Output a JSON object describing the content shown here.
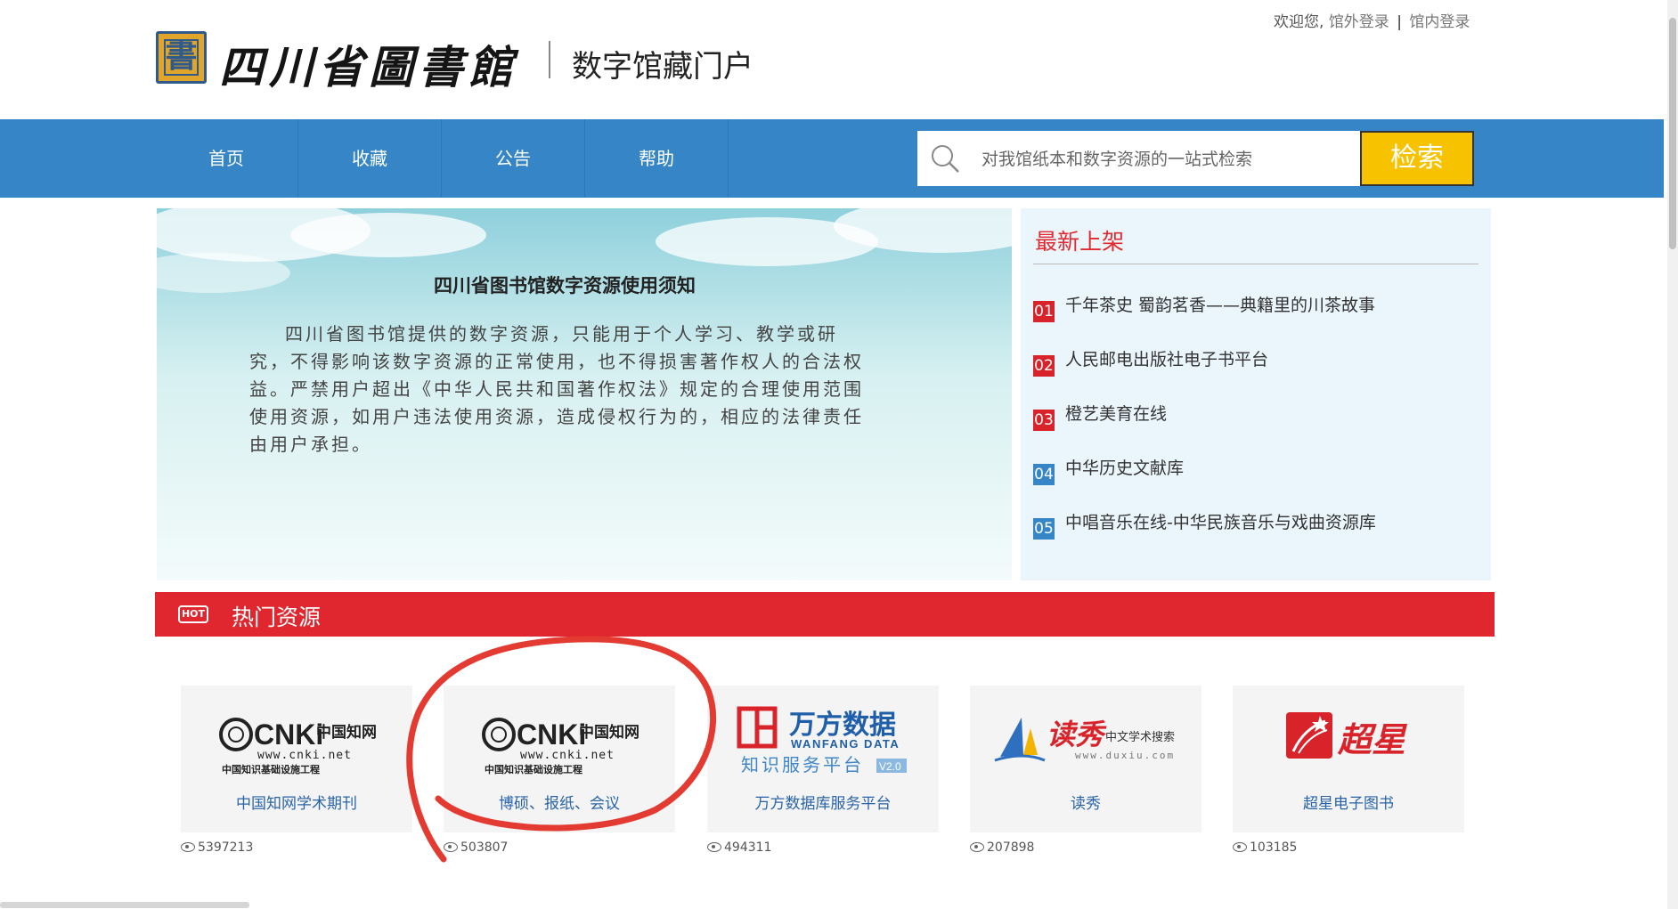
{
  "header": {
    "welcome": "欢迎您,",
    "login_external": "馆外登录",
    "separator": "|",
    "login_internal": "馆内登录",
    "logo_glyph": "書",
    "library_name": "四川省圖書館",
    "portal_title": "数字馆藏门户"
  },
  "nav": {
    "items": [
      {
        "label": "首页"
      },
      {
        "label": "收藏"
      },
      {
        "label": "公告"
      },
      {
        "label": "帮助"
      }
    ],
    "search_placeholder": "对我馆纸本和数字资源的一站式检索",
    "search_button": "检索"
  },
  "notice": {
    "title": "四川省图书馆数字资源使用须知",
    "body": "四川省图书馆提供的数字资源，只能用于个人学习、教学或研究，不得影响该数字资源的正常使用，也不得损害著作权人的合法权益。严禁用户超出《中华人民共和国著作权法》规定的合理使用范围使用资源，如用户违法使用资源，造成侵权行为的，相应的法律责任由用户承担。"
  },
  "latest": {
    "title": "最新上架",
    "items": [
      {
        "num": "01",
        "label": "千年茶史 蜀韵茗香——典籍里的川茶故事"
      },
      {
        "num": "02",
        "label": "人民邮电出版社电子书平台"
      },
      {
        "num": "03",
        "label": "橙艺美育在线"
      },
      {
        "num": "04",
        "label": "中华历史文献库"
      },
      {
        "num": "05",
        "label": "中唱音乐在线-中华民族音乐与戏曲资源库"
      }
    ]
  },
  "hot": {
    "badge": "HOT",
    "title": "热门资源",
    "resources": [
      {
        "name": "中国知网学术期刊",
        "views": "5397213",
        "logo_main": "CNKi",
        "logo_cn": "中国知网",
        "logo_url": "www.cnki.net",
        "logo_sub": "中国知识基础设施工程"
      },
      {
        "name": "博硕、报纸、会议",
        "views": "503807",
        "logo_main": "CNKi",
        "logo_cn": "中国知网",
        "logo_url": "www.cnki.net",
        "logo_sub": "中国知识基础设施工程"
      },
      {
        "name": "万方数据库服务平台",
        "views": "494311",
        "logo_main": "万方数据",
        "logo_en": "WANFANG DATA",
        "logo_sub": "知识服务平台",
        "logo_ver": "V2.0"
      },
      {
        "name": "读秀",
        "views": "207898",
        "logo_main": "读秀",
        "logo_sub": "中文学术搜索",
        "logo_url": "www.duxiu.com"
      },
      {
        "name": "超星电子图书",
        "views": "103185",
        "logo_main": "超星"
      }
    ]
  },
  "colors": {
    "nav_blue": "#3585c7",
    "hot_red": "#e0262e",
    "search_yellow": "#f7c300",
    "link_blue": "#2a64a8",
    "annotation_red": "#e33b32"
  }
}
